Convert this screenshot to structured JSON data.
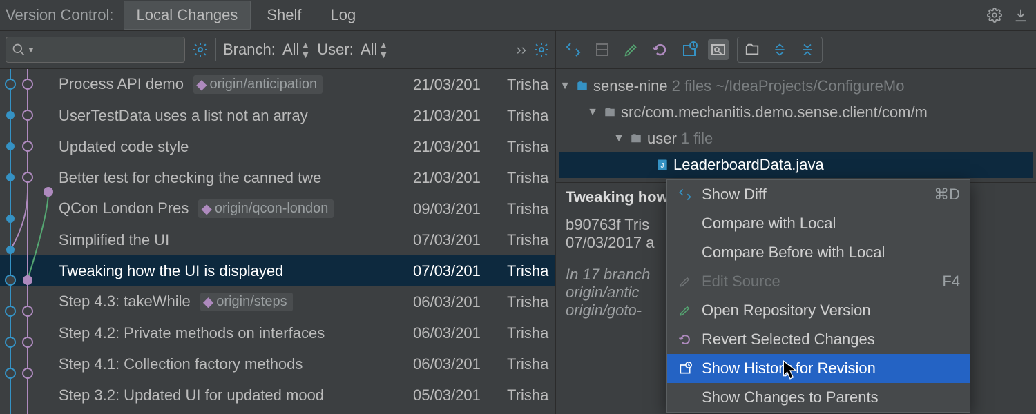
{
  "header": {
    "title": "Version Control:",
    "tabs": [
      "Local Changes",
      "Shelf",
      "Log"
    ],
    "active_tab_index": 0
  },
  "search": {
    "placeholder": ""
  },
  "filters": {
    "branch_label": "Branch:",
    "branch_value": "All",
    "user_label": "User:",
    "user_value": "All"
  },
  "commits": [
    {
      "message": "Process API demo",
      "tag": "origin/anticipation",
      "date": "21/03/201",
      "author": "Trisha"
    },
    {
      "message": "UserTestData uses a list not an array",
      "date": "21/03/201",
      "author": "Trisha"
    },
    {
      "message": "Updated code style",
      "date": "21/03/201",
      "author": "Trisha"
    },
    {
      "message": "Better test for checking the canned twe",
      "date": "21/03/201",
      "author": "Trisha"
    },
    {
      "message": "QCon London Pres",
      "tag": "origin/qcon-london",
      "date": "09/03/201",
      "author": "Trisha"
    },
    {
      "message": "Simplified the UI",
      "date": "07/03/201",
      "author": "Trisha"
    },
    {
      "message": "Tweaking how the UI is displayed",
      "date": "07/03/201",
      "author": "Trisha",
      "selected": true
    },
    {
      "message": "Step 4.3: takeWhile",
      "tag": "origin/steps",
      "date": "06/03/201",
      "author": "Trisha"
    },
    {
      "message": "Step 4.2: Private methods on interfaces",
      "date": "06/03/201",
      "author": "Trisha"
    },
    {
      "message": "Step 4.1: Collection factory methods",
      "date": "06/03/201",
      "author": "Trisha"
    },
    {
      "message": "Step 3.2: Updated UI for updated mood",
      "date": "05/03/201",
      "author": "Trisha"
    }
  ],
  "changed_files": {
    "root": {
      "name": "sense-nine",
      "count": "2 files",
      "path": "~/IdeaProjects/ConfigureMo"
    },
    "src": {
      "name": "src/com.mechanitis.demo.sense.client/com/m"
    },
    "pkg": {
      "name": "user",
      "count": "1 file"
    },
    "file": {
      "name": "LeaderboardData.java"
    }
  },
  "details": {
    "title": "Tweaking how",
    "hash_line": "b90763f Tris",
    "date": "07/03/2017 a",
    "branches_line": "In 17 branch",
    "branch1": "origin/antic",
    "branch2": "origin/goto-"
  },
  "context_menu": {
    "items": [
      {
        "id": "show-diff",
        "label": "Show Diff",
        "icon": "diff",
        "shortcut": "⌘D"
      },
      {
        "id": "compare-local",
        "label": "Compare with Local"
      },
      {
        "id": "compare-before",
        "label": "Compare Before with Local"
      },
      {
        "id": "edit-source",
        "label": "Edit Source",
        "icon": "edit",
        "shortcut": "F4",
        "disabled": true
      },
      {
        "id": "open-repo",
        "label": "Open Repository Version",
        "icon": "open"
      },
      {
        "id": "revert",
        "label": "Revert Selected Changes",
        "icon": "revert"
      },
      {
        "id": "history",
        "label": "Show History for Revision",
        "icon": "history",
        "highlight": true
      },
      {
        "id": "parents",
        "label": "Show Changes to Parents"
      }
    ]
  }
}
